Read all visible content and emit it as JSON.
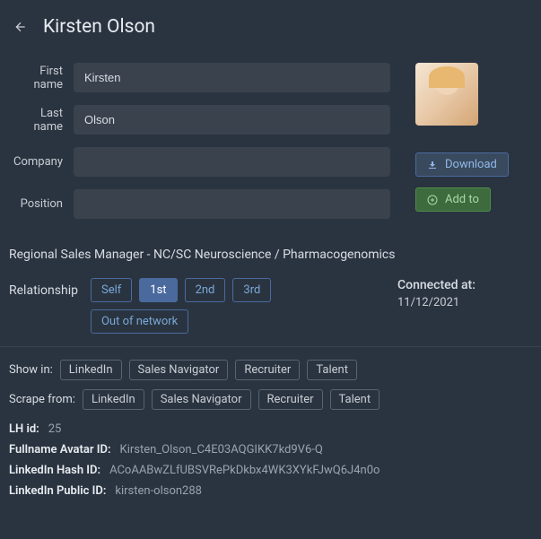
{
  "header": {
    "title": "Kirsten Olson"
  },
  "fields": {
    "first_name_label": "First name",
    "first_name_value": "Kirsten",
    "last_name_label": "Last name",
    "last_name_value": "Olson",
    "company_label": "Company",
    "company_value": "",
    "position_label": "Position",
    "position_value": ""
  },
  "actions": {
    "download": "Download",
    "add_to": "Add to"
  },
  "headline": "Regional Sales Manager - NC/SC Neuroscience / Pharmacogenomics",
  "relationship": {
    "label": "Relationship",
    "options": [
      "Self",
      "1st",
      "2nd",
      "3rd",
      "Out of network"
    ],
    "selected": "1st"
  },
  "connected": {
    "label": "Connected at:",
    "date": "11/12/2021"
  },
  "show_in": {
    "label": "Show in:",
    "options": [
      "LinkedIn",
      "Sales Navigator",
      "Recruiter",
      "Talent"
    ]
  },
  "scrape_from": {
    "label": "Scrape from:",
    "options": [
      "LinkedIn",
      "Sales Navigator",
      "Recruiter",
      "Talent"
    ]
  },
  "ids": {
    "lh_label": "LH id:",
    "lh_value": "25",
    "fullname_label": "Fullname Avatar ID:",
    "fullname_value": "Kirsten_Olson_C4E03AQGIKK7kd9V6-Q",
    "hash_label": "LinkedIn Hash ID:",
    "hash_value": "ACoAABwZLfUBSVRePkDkbx4WK3XYkFJwQ6J4n0o",
    "public_label": "LinkedIn Public ID:",
    "public_value": "kirsten-olson288"
  }
}
